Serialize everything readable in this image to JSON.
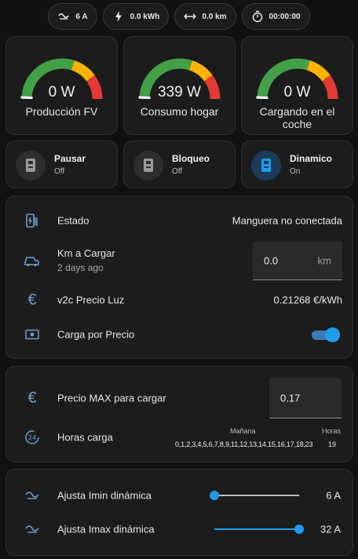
{
  "chips": [
    {
      "icon": "current-wave-icon",
      "text": "6 A"
    },
    {
      "icon": "bolt-icon",
      "text": "0.0 kWh"
    },
    {
      "icon": "arrows-horizontal-icon",
      "text": "0.0 km"
    },
    {
      "icon": "timer-icon",
      "text": "00:00:00"
    }
  ],
  "gauges": [
    {
      "value": "0 W",
      "name": "Producción FV",
      "level": 0
    },
    {
      "value": "339 W",
      "name": "Consumo hogar",
      "level": 0.01
    },
    {
      "value": "0 W",
      "name": "Cargando en el coche",
      "level": 0
    }
  ],
  "buttons": [
    {
      "name": "Pausar",
      "state": "Off"
    },
    {
      "name": "Bloqueo",
      "state": "Off"
    },
    {
      "name": "Dinamico",
      "state": "On"
    }
  ],
  "status": {
    "estado_label": "Estado",
    "estado_value": "Manguera no conectada",
    "km_label": "Km a Cargar",
    "km_sub": "2 days ago",
    "km_value": "0.0",
    "km_unit": "km",
    "precio_label": "v2c Precio Luz",
    "precio_value": "0.21268 €/kWh",
    "carga_label": "Carga por Precio",
    "carga_on": true
  },
  "pricing": {
    "max_label": "Precio MAX para cargar",
    "max_value": "0.17",
    "horas_label": "Horas carga",
    "manana_header": "Mañana",
    "horas_header": "Horas",
    "manana_value": "0,1,2,3,4,5,6,7,8,9,11,12,13,14,15,16,17,18,23",
    "horas_value": "19"
  },
  "sliders": [
    {
      "label": "Ajusta Imin dinámica",
      "value": "6 A",
      "level": 0
    },
    {
      "label": "Ajusta Imax dinámica",
      "value": "32 A",
      "level": 1
    }
  ],
  "colors": {
    "accent": "#1e9bea",
    "gauge_green": "#43a047",
    "gauge_yellow": "#ffb300",
    "gauge_red": "#e53935"
  }
}
